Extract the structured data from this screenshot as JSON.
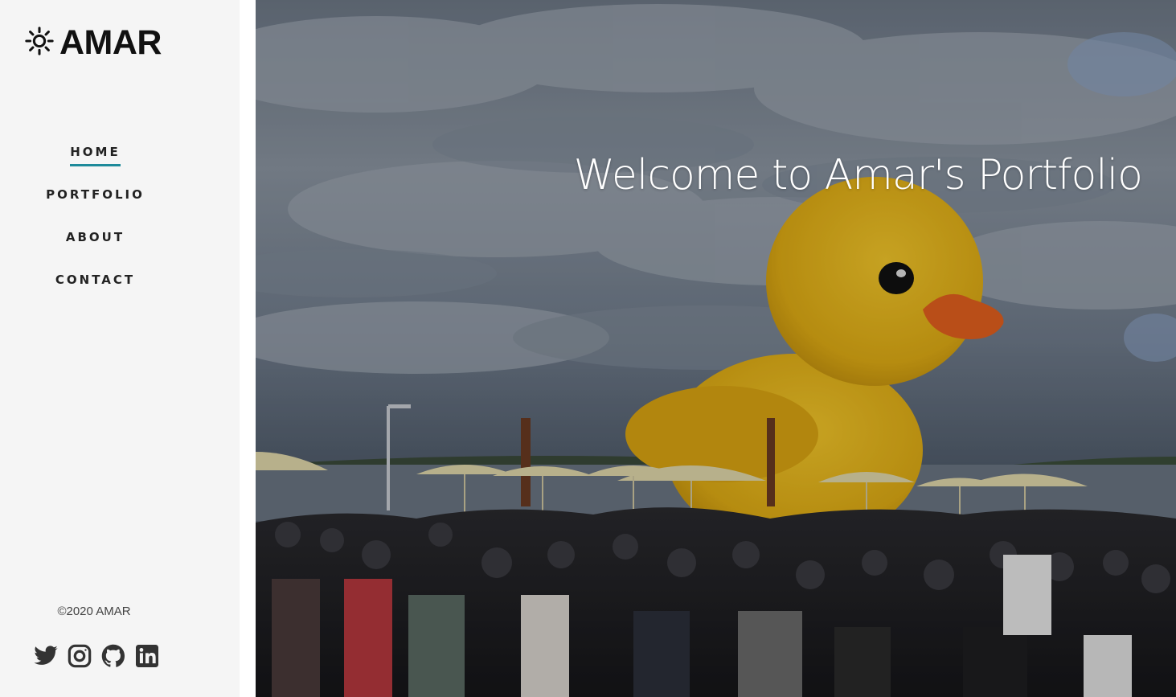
{
  "brand": {
    "name": "AMAR",
    "logo_icon": "sun-icon"
  },
  "nav": {
    "items": [
      {
        "label": "HOME",
        "active": true
      },
      {
        "label": "PORTFOLIO",
        "active": false
      },
      {
        "label": "ABOUT",
        "active": false
      },
      {
        "label": "CONTACT",
        "active": false
      }
    ]
  },
  "footer": {
    "copyright": "©2020 AMAR",
    "socials": [
      "twitter-icon",
      "instagram-icon",
      "github-icon",
      "linkedin-icon"
    ]
  },
  "hero": {
    "title": "Welcome to Amar's Portfolio",
    "image_description_icon": "rubber-duck-crowd-photo"
  },
  "colors": {
    "sidebar_bg": "#f5f5f5",
    "active_underline": "#1e8a9a",
    "text_dark": "#222222",
    "duck_yellow": "#e8b61c",
    "beak_orange": "#e2601e"
  }
}
